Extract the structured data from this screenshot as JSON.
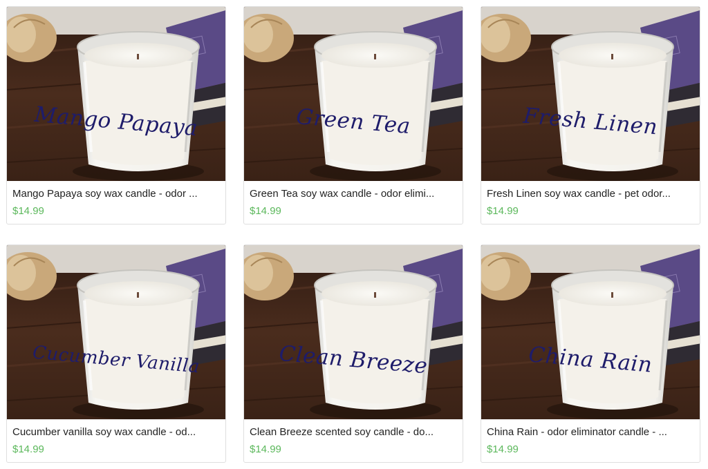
{
  "products": [
    {
      "scent": "Mango Papaya",
      "title": "Mango Papaya soy wax candle - odor ...",
      "price": "$14.99"
    },
    {
      "scent": "Green Tea",
      "title": "Green Tea soy wax candle - odor elimi...",
      "price": "$14.99"
    },
    {
      "scent": "Fresh Linen",
      "title": "Fresh Linen soy wax candle - pet odor...",
      "price": "$14.99"
    },
    {
      "scent": "Cucumber Vanilla",
      "title": "Cucumber vanilla soy wax candle - od...",
      "price": "$14.99"
    },
    {
      "scent": "Clean Breeze",
      "title": "Clean Breeze scented soy candle - do...",
      "price": "$14.99"
    },
    {
      "scent": "China Rain",
      "title": "China Rain - odor eliminator candle - ...",
      "price": "$14.99"
    }
  ],
  "colors": {
    "price": "#5cb85c",
    "label_ink": "#1e1c6a",
    "wood": "#4a2c1d",
    "book": "#5a4a86",
    "wax": "#f4f1ea"
  }
}
